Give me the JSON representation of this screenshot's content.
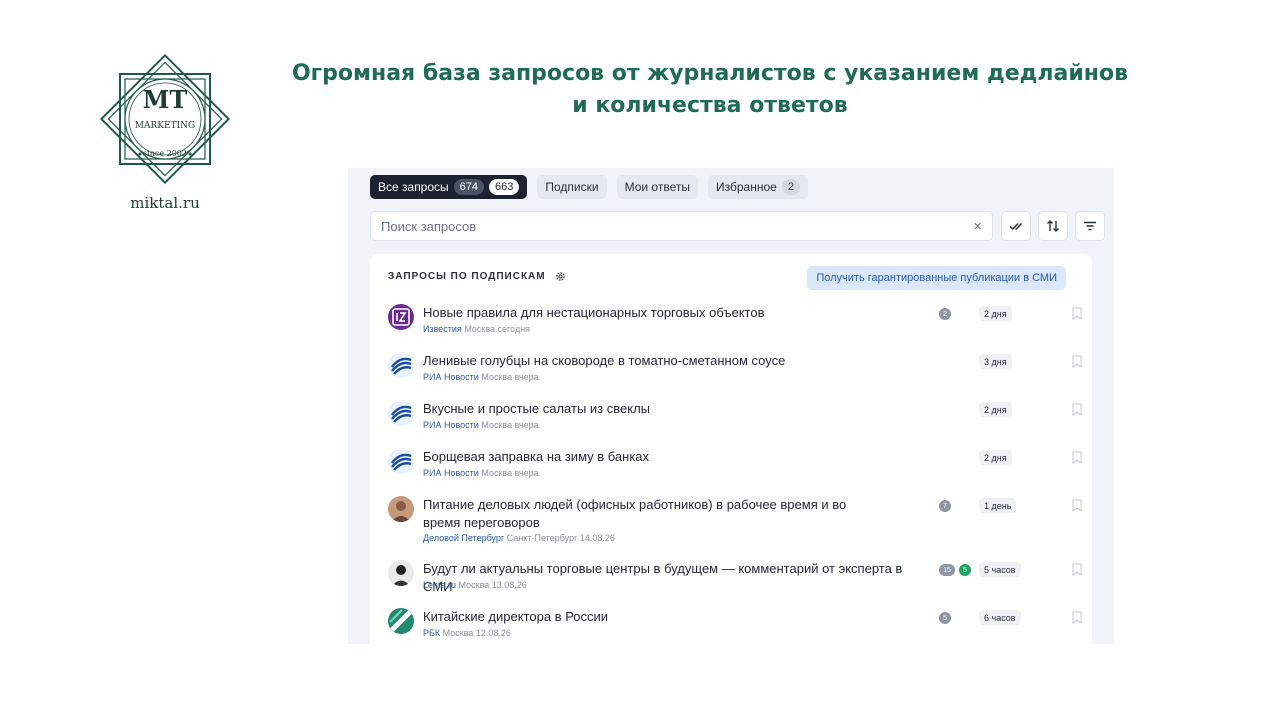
{
  "logo": {
    "letters": "MT",
    "tagline": "MARKETING",
    "since": "since 2002",
    "site": "miktal.ru"
  },
  "headline": {
    "line1": "Огромная база запросов от журналистов с указанием дедлайнов",
    "line2": "и количества ответов"
  },
  "tabs": [
    {
      "label": "Все запросы",
      "count_a": "674",
      "count_b": "663",
      "active": true
    },
    {
      "label": "Подписки"
    },
    {
      "label": "Мои ответы"
    },
    {
      "label": "Избранное",
      "count": "2"
    }
  ],
  "search": {
    "placeholder": "Поиск запросов",
    "clear": "×"
  },
  "section": {
    "title": "ЗАПРОСЫ ПО ПОДПИСКАМ",
    "promo_button": "Получить гарантированные публикации в СМИ"
  },
  "colors": {
    "brand": "#1f6b55",
    "accent": "#2b5aa8",
    "active_tab": "#1c2230",
    "green_badge": "#21a366"
  },
  "requests": [
    {
      "title": "Новые правила для нестационарных торговых объектов",
      "source": "Известия",
      "place_time": "Москва сегодня",
      "answers": "2",
      "deadline": "2 дня",
      "avatar": "izvestia-logo"
    },
    {
      "title": "Ленивые голубцы на сковороде в томатно-сметанном соусе",
      "source": "РИА Новости",
      "place_time": "Москва вчера",
      "deadline": "3 дня",
      "avatar": "ria-logo"
    },
    {
      "title": "Вкусные и простые салаты из свеклы",
      "source": "РИА Новости",
      "place_time": "Москва вчера",
      "deadline": "2 дня",
      "avatar": "ria-logo"
    },
    {
      "title": "Борщевая заправка на зиму в банках",
      "source": "РИА Новости",
      "place_time": "Москва вчера",
      "deadline": "2 дня",
      "avatar": "ria-logo"
    },
    {
      "title": "Питание деловых людей (офисных работников) в рабочее время и во время переговоров",
      "source": "Деловой Петербург",
      "place_time": "Санкт-Петербург 14.08.26",
      "answers": "7",
      "deadline": "1 день",
      "avatar": "person-photo"
    },
    {
      "title": "Будут ли актуальны торговые центры в будущем — комментарий от эксперта в СМИ",
      "source": "Lenta.ru",
      "place_time": "Москва 13.08.26",
      "answers": "15",
      "new_answers": "5",
      "deadline": "5 часов",
      "avatar": "person-photo"
    },
    {
      "title": "Китайские директора в России",
      "source": "РБК",
      "place_time": "Москва 12.08.26",
      "answers": "5",
      "deadline": "6 часов",
      "avatar": "rbc-logo"
    }
  ]
}
